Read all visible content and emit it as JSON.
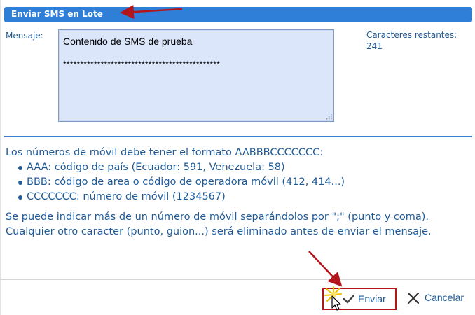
{
  "dialog": {
    "title": "Enviar SMS en Lote"
  },
  "message": {
    "label": "Mensaje:",
    "line1": "Contenido de SMS de prueba",
    "line2": "**********************************************"
  },
  "chars": {
    "label": "Caracteres restantes:",
    "value": "241"
  },
  "info": {
    "intro": "Los números de móvil debe tener el formato AABBBCCCCCCC:",
    "bullets": [
      "AAA: código de país (Ecuador: 591, Venezuela: 58)",
      "BBB: código de area o código de operadora móvil (412, 414...)",
      "CCCCCCC: número de móvil (1234567)"
    ],
    "note": "Se puede indicar más de un número de móvil separándolos por \";\" (punto y coma). Cualquier otro caracter (punto, guion...) será eliminado antes de enviar el mensaje."
  },
  "actions": {
    "send_label": "Enviar",
    "cancel_label": "Cancelar"
  },
  "colors": {
    "accent": "#2f7ed8",
    "text_blue": "#1f5b99",
    "textarea_bg": "#dbe6fa",
    "highlight_red": "#b4141c"
  },
  "icons": {
    "send": "check-icon",
    "cancel": "x-icon",
    "annotation": "red-arrow-icon"
  }
}
